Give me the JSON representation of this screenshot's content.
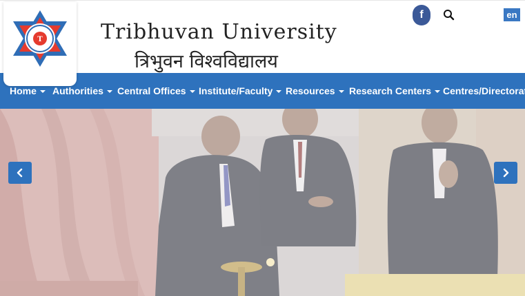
{
  "header": {
    "title_en": "Tribhuvan University",
    "title_np": "त्रिभुवन विश्वविद्यालय",
    "social": {
      "facebook_icon_text": "f"
    },
    "language_label": "en",
    "accent_color": "#2e72bd"
  },
  "logo": {
    "name": "tribhuvan-university-emblem",
    "text_ring": [
      "TRIBHUVAN",
      "UNIVERSITY",
      "KATHMANDU",
      "NEPAL"
    ]
  },
  "nav": {
    "items": [
      {
        "label": "Home"
      },
      {
        "label": "Authorities"
      },
      {
        "label": "Central Offices"
      },
      {
        "label": "Institute/Faculty"
      },
      {
        "label": "Resources"
      },
      {
        "label": "Research Centers"
      },
      {
        "label": "Centres/Directorate"
      }
    ]
  },
  "carousel": {
    "prev_icon": "chevron-left-icon",
    "next_icon": "chevron-right-icon"
  }
}
